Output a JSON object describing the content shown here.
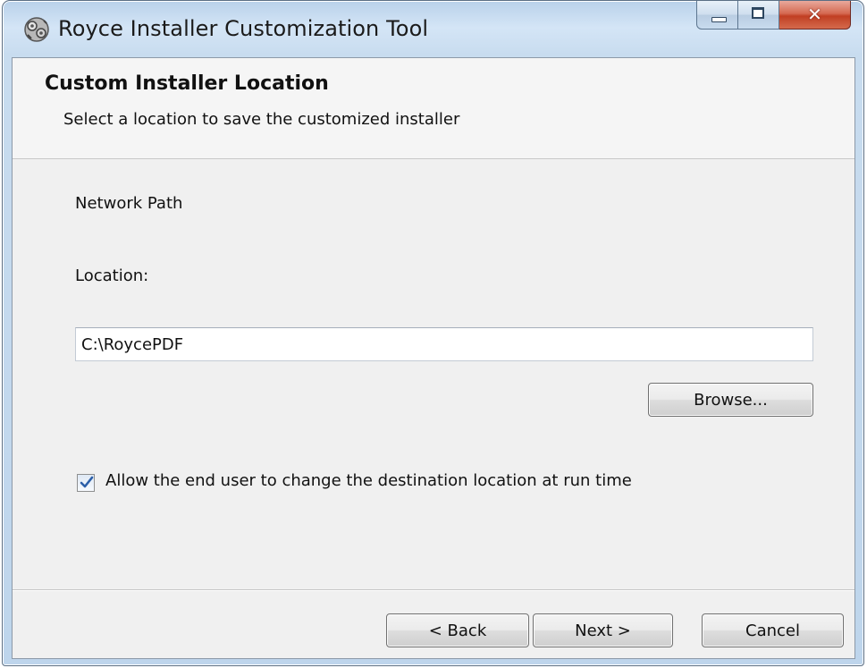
{
  "window": {
    "title": "Royce Installer Customization Tool",
    "icon": "gear-app-icon",
    "controls": {
      "minimize": "minimize-icon",
      "maximize": "maximize-icon",
      "close": "close-icon"
    }
  },
  "banner": {
    "title": "Custom Installer Location",
    "subtitle": "Select a location to save the customized installer"
  },
  "body": {
    "network_path_label": "Network Path",
    "location_label": "Location:",
    "location_value": "C:\\RoycePDF",
    "browse_label": "Browse...",
    "allow_change_label": "Allow the end user to change the destination location at run time",
    "allow_change_checked": true
  },
  "footer": {
    "back_label": "< Back",
    "next_label": "Next >",
    "cancel_label": "Cancel"
  },
  "colors": {
    "frame": "#bed5ec",
    "client": "#f0f0f0",
    "close_button": "#c13f23",
    "checkmark": "#2c5fa8"
  }
}
